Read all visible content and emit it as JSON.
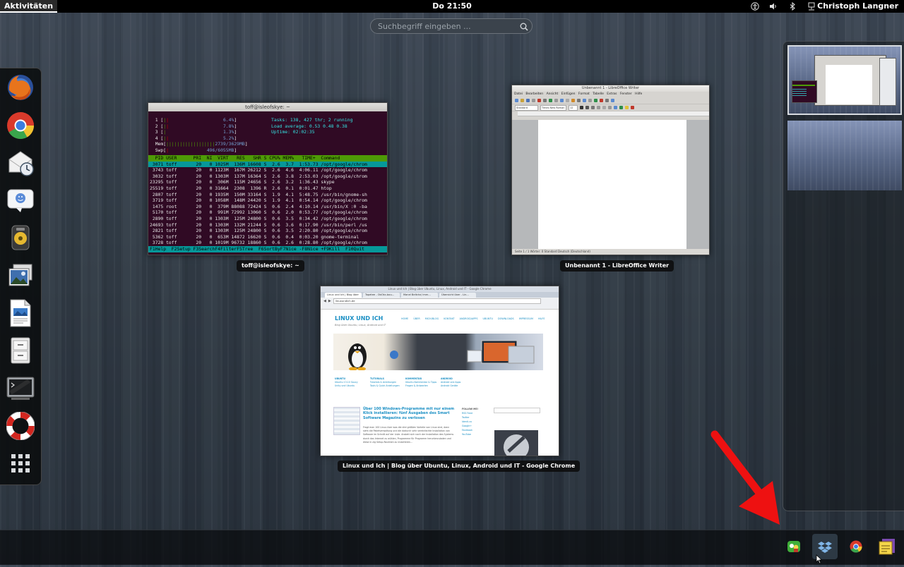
{
  "topbar": {
    "activities": "Aktivitäten",
    "clock": "Do 21:50",
    "user": "Christoph Langner",
    "status_icons": [
      "accessibility-icon",
      "volume-icon",
      "bluetooth-icon",
      "network-icon"
    ]
  },
  "search": {
    "placeholder": "Suchbegriff eingeben ..."
  },
  "dash": {
    "items": [
      "firefox-icon",
      "chrome-icon",
      "mail-clock-icon",
      "chat-icon",
      "music-player-icon",
      "image-viewer-icon",
      "document-icon",
      "file-cabinet-icon",
      "terminal-icon",
      "help-lifebuoy-icon",
      "show-apps-grid-icon"
    ]
  },
  "windows": {
    "terminal": {
      "title": "toff@isleofskye: ~",
      "label": "toff@isleofskye: ~",
      "meters": [
        {
          "name": "1",
          "value": "6.4%"
        },
        {
          "name": "2",
          "value": "7.8%"
        },
        {
          "name": "3",
          "value": "1.3%"
        },
        {
          "name": "4",
          "value": "5.2%"
        }
      ],
      "mem": "2739/3629MB",
      "swp": "496/6055MB",
      "tasks": "Tasks: 138, 427 thr; 2 running",
      "load": "Load average: 0.53 0.48 0.38",
      "uptime": "Uptime: 02:02:35",
      "header": "  PID USER      PRI  NI  VIRT   RES   SHR S CPU% MEM%   TIME+  Command",
      "rows": [
        " 3071 toff       20   0 1025M  136M 16608 S  2.6  3.7  1:53.73 /opt/google/chrom",
        " 3743 toff       20   0 1123M  167M 26212 S  2.6  4.6  4:06.11 /opt/google/chrom",
        " 3032 toff       20   0 1303M  137M 16364 S  2.6  3.8  2:53.03 /opt/google/chrom",
        "23295 toff       20   0  306M  115M 24656 S  2.6  3.2  1:36.43 skype",
        "25519 toff       20   0 31664  2308  1396 R  2.6  0.1  0:01.47 htop",
        " 2807 toff       20   0 1935M  150M 33164 S  1.9  4.1  5:48.75 /usr/bin/gnome-sh",
        " 3719 toff       20   0 1058M  148M 24420 S  1.9  4.1  0:54.14 /opt/google/chrom",
        " 1475 root       20   0  379M 88088 72424 S  0.6  2.4  4:10.14 /usr/bin/X :0 -ba",
        " 5170 toff       20   0  991M 72992 13060 S  0.6  2.0  0:53.77 /opt/google/chrom",
        " 2890 toff       20   0 1303M  125M 24800 S  0.6  3.5  0:34.42 /opt/google/chrom",
        "24693 toff       20   0 1303M  132M 21244 S  0.6  3.6  0:17.90 /usr/bin/perl /us",
        " 2821 toff       20   0 1303M  125M 24800 S  0.6  3.5  2:20.80 /opt/google/chrom",
        " 5362 toff       20   0  653M 14872 16620 S  0.6  0.4  0:03.20 gnome-terminal",
        " 3728 toff       20   0 1019M 96732 18860 S  0.6  2.6  0:28.80 /opt/google/chrom"
      ],
      "fkeys": "F1Help  F2Setup F3SearchF4FilterF5Tree  F6SortByF7Nice -F8Nice +F9Kill  F10Quit"
    },
    "writer": {
      "title": "Unbenannt 1 - LibreOffice Writer",
      "label": "Unbenannt 1 - LibreOffice Writer",
      "menu": "Datei Bearbeiten Ansicht Einfügen Format Tabelle Extras Fenster Hilfe",
      "style_box": "Standard",
      "font_box": "Times New Roman",
      "size_box": "12",
      "status": "Seite 1 / 1     Wörter: 0     Standard     Deutsch (Deutschland)"
    },
    "chrome": {
      "title": "Linux und Ich | Blog über Ubuntu, Linux, Android und IT - Google Chrome",
      "label": "Linux und Ich | Blog über Ubuntu, Linux, Android und IT - Google Chrome",
      "tabs": [
        "Linux und Ich | Blog über",
        "Tapetee - ObOkc-bou...",
        "Manel Beltrán/ imm...",
        "Übersicht über - Lin..."
      ],
      "url": "linuxundich.de",
      "site_title": "LINUX UND ICH",
      "site_subtitle": "Blog über Ubuntu, Linux, Android und IT",
      "site_nav": "HOME  ÜBER MICH/BLOG  KONTAKT  ANDROID/APPS  UBUNTU DOWNLOADS  IMPRESSUM  HILFE",
      "columns": [
        {
          "head": "UBUNTU",
          "lines": [
            "Ubuntu 13.10 Saucy",
            "Unity und Ubuntu"
          ]
        },
        {
          "head": "TUTORIALS",
          "lines": [
            "Tutorials & Anleitungen",
            "Tools & Quick Anleitungen"
          ]
        },
        {
          "head": "KOMMENTAR",
          "lines": [
            "Ubuntu Kommentar & Tipps",
            "Fragen & Antworten"
          ]
        },
        {
          "head": "ANDROID",
          "lines": [
            "Android und Apps",
            "Android Geräte"
          ]
        }
      ],
      "post_title": "Über 100 Windows-Programme mit nur einem Klick installieren: fünf Ausgaben des Smart Software Magazins zu verlosen",
      "post_body": "Fragt man 100 Linux-User was die drei größten Vorteile von Linux sind, dann sieht die Paketverwaltung und die dadurch sehr vereinfachte Installation von Software im Schnitt auf der Liste. Anstatt sich nach der Installation des Systems durch das Internet zu wühlen, Programme für Programm herunterzuladen und diese in zig Setup-Routinen zu installieren...",
      "sidebar_head": "FOLLOW ME!",
      "sidebar_items": [
        "RSS Feed",
        "Twitter",
        "Identi.ca",
        "Google+",
        "Facebook",
        "YouTube"
      ]
    }
  },
  "tray": {
    "items": [
      "green-chat-icon",
      "dropbox-icon",
      "chrome-icon",
      "notes-icon"
    ]
  },
  "colors": {
    "accent_blue": "#1a8fc4",
    "arrow_red": "#ee1111",
    "terminal_bg": "#300a24",
    "htop_green": "#4e9a06",
    "htop_cyan": "#06989a"
  }
}
